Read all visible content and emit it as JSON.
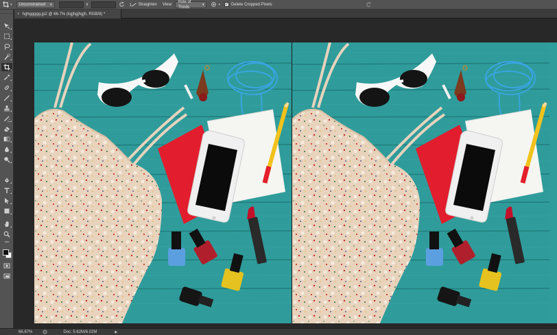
{
  "options_bar": {
    "ratio_select": "Unconstrained",
    "width_value": "",
    "swap_symbol": "x",
    "height_value": "",
    "straighten_label": "Straighten",
    "view_label": "View:",
    "view_select": "Rule of Thirds",
    "delete_cropped_checked": true,
    "delete_cropped_label": "Delete Cropped Pixels",
    "icons": [
      "crop-tool-icon",
      "clear-icon",
      "straighten-icon",
      "gear-icon",
      "reset-icon"
    ]
  },
  "document": {
    "tab_close": "×",
    "tab_title": "hghggggg.jp2 @ 66.7% (kgjhgjhgjh, RGB/8) *"
  },
  "toolbar": {
    "tools": [
      "move-tool-icon",
      "marquee-tool-icon",
      "lasso-tool-icon",
      "quick-selection-icon",
      "crop-tool-icon",
      "eyedropper-icon",
      "healing-brush-icon",
      "brush-icon",
      "clone-stamp-icon",
      "history-brush-icon",
      "eraser-icon",
      "gradient-icon",
      "blur-icon",
      "dodge-icon",
      "pen-icon",
      "type-tool-icon",
      "path-selection-icon",
      "shape-tool-icon",
      "hand-tool-icon",
      "zoom-tool-icon"
    ],
    "active_tool": "crop-tool-icon",
    "foreground_color": "#111111",
    "background_color": "#ffffff"
  },
  "status_bar": {
    "zoom": "66.67%",
    "doc_info": "Doc: 5.62M/6.02M",
    "arrow": "▶"
  },
  "colors": {
    "teal_background": "#2f9d9c",
    "interface_gray": "#535353"
  }
}
